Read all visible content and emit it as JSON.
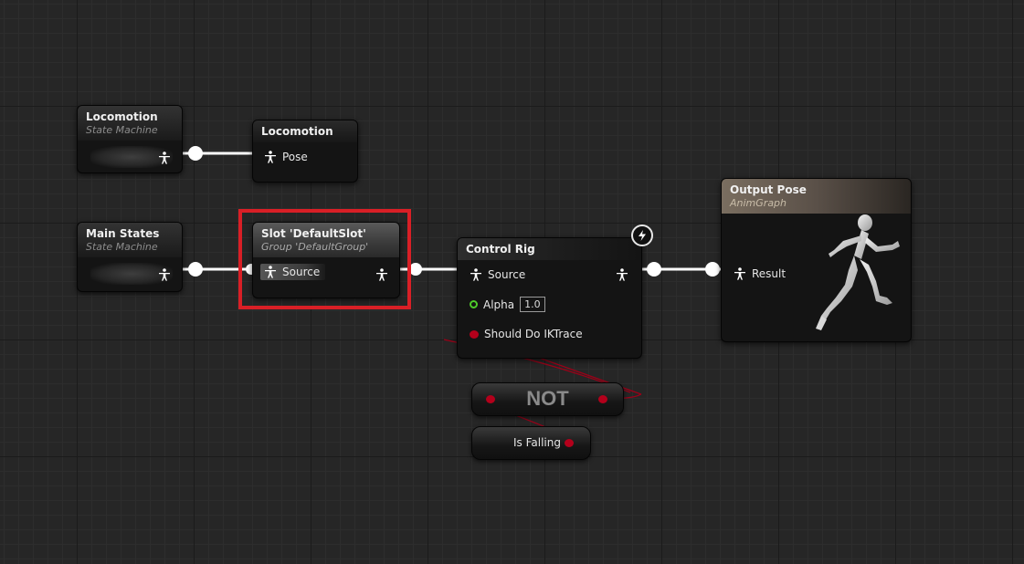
{
  "nodes": {
    "locomotion_sm": {
      "title": "Locomotion",
      "subtitle": "State Machine"
    },
    "locomotion_pose": {
      "title": "Locomotion",
      "pin": "Pose"
    },
    "main_states_sm": {
      "title": "Main States",
      "subtitle": "State Machine"
    },
    "slot": {
      "title": "Slot 'DefaultSlot'",
      "subtitle": "Group 'DefaultGroup'",
      "pin": "Source"
    },
    "control_rig": {
      "title": "Control Rig",
      "pins": {
        "source": "Source",
        "alpha": "Alpha",
        "alpha_value": "1.0",
        "ik_trace": "Should Do IKTrace"
      }
    },
    "output_pose": {
      "title": "Output Pose",
      "subtitle": "AnimGraph",
      "pin": "Result"
    },
    "not_node": {
      "label": "NOT"
    },
    "is_falling": {
      "label": "Is Falling"
    }
  },
  "colors": {
    "selection": "#d91f26",
    "exec_pin": "#b3001b",
    "float_pin": "#4ecb2a",
    "pose_wire": "#ffffff",
    "bool_wire": "#a00018"
  },
  "icons": [
    "pose-icon",
    "lightning-icon",
    "mannequin-preview"
  ]
}
